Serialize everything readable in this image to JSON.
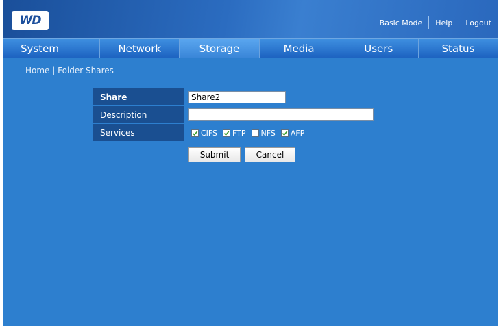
{
  "header": {
    "logo_text": "WD",
    "links": {
      "basic_mode": "Basic Mode",
      "help": "Help",
      "logout": "Logout"
    }
  },
  "nav": {
    "tabs": [
      {
        "label": "System"
      },
      {
        "label": "Network"
      },
      {
        "label": "Storage",
        "active": true
      },
      {
        "label": "Media"
      },
      {
        "label": "Users"
      },
      {
        "label": "Status"
      }
    ]
  },
  "breadcrumb": {
    "home": "Home",
    "separator": "|",
    "current": "Folder Shares"
  },
  "form": {
    "share_label": "Share",
    "share_value": "Share2",
    "description_label": "Description",
    "description_value": "",
    "services_label": "Services",
    "services": [
      {
        "label": "CIFS",
        "checked": true
      },
      {
        "label": "FTP",
        "checked": true
      },
      {
        "label": "NFS",
        "checked": false
      },
      {
        "label": "AFP",
        "checked": true
      }
    ],
    "submit_label": "Submit",
    "cancel_label": "Cancel"
  },
  "colors": {
    "background": "#2d7fcf",
    "label_bg": "#1a4f91",
    "check": "#3a9a2a"
  }
}
